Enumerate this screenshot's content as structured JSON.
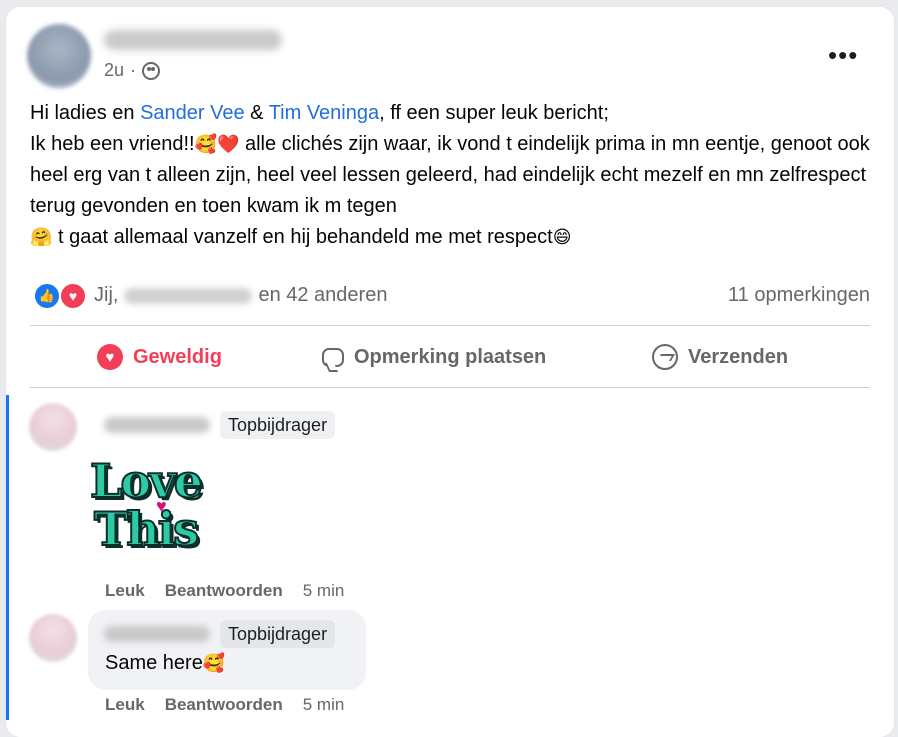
{
  "post": {
    "time": "2u",
    "more_label": "•••",
    "text_line1_prefix": "Hi ladies en ",
    "mention1": "Sander Vee",
    "amp": " & ",
    "mention2": "Tim Veninga",
    "text_line1_suffix": ", ff een super leuk bericht;",
    "text_line2_a": "Ik heb een vriend!!",
    "emoji_smiling_hearts": "🥰",
    "emoji_red_heart": "❤️",
    "text_line2_b": " alle clichés zijn waar, ik vond t eindelijk prima in mn eentje, genoot ook heel erg van t alleen zijn, heel veel lessen geleerd, had eindelijk echt mezelf en mn zelfrespect terug gevonden en toen kwam ik m tegen",
    "emoji_hug": "🤗",
    "text_line3": " t gaat allemaal vanzelf en hij behandeld me met respect",
    "emoji_grin": "😄"
  },
  "reactions": {
    "prefix": "Jij,",
    "suffix": "en 42 anderen",
    "comments_count": "11 opmerkingen"
  },
  "actions": {
    "love_label": "Geweldig",
    "comment_label": "Opmerking plaatsen",
    "send_label": "Verzenden"
  },
  "comments": [
    {
      "badge": "Topbijdrager",
      "sticker_line1": "Love",
      "sticker_line2": "This",
      "like_label": "Leuk",
      "reply_label": "Beantwoorden",
      "time": "5 min"
    },
    {
      "badge": "Topbijdrager",
      "text": "Same here",
      "emoji": "🥰",
      "like_label": "Leuk",
      "reply_label": "Beantwoorden",
      "time": "5 min"
    }
  ],
  "colors": {
    "accent_blue": "#1877f2",
    "love_red": "#f33e58",
    "mention_blue": "#216fdb",
    "sticker_teal": "#2dcaa6"
  },
  "icons": [
    "globe-icon",
    "more-options-icon",
    "like-reaction-icon",
    "love-reaction-icon",
    "heart-icon",
    "comment-icon",
    "messenger-icon"
  ]
}
